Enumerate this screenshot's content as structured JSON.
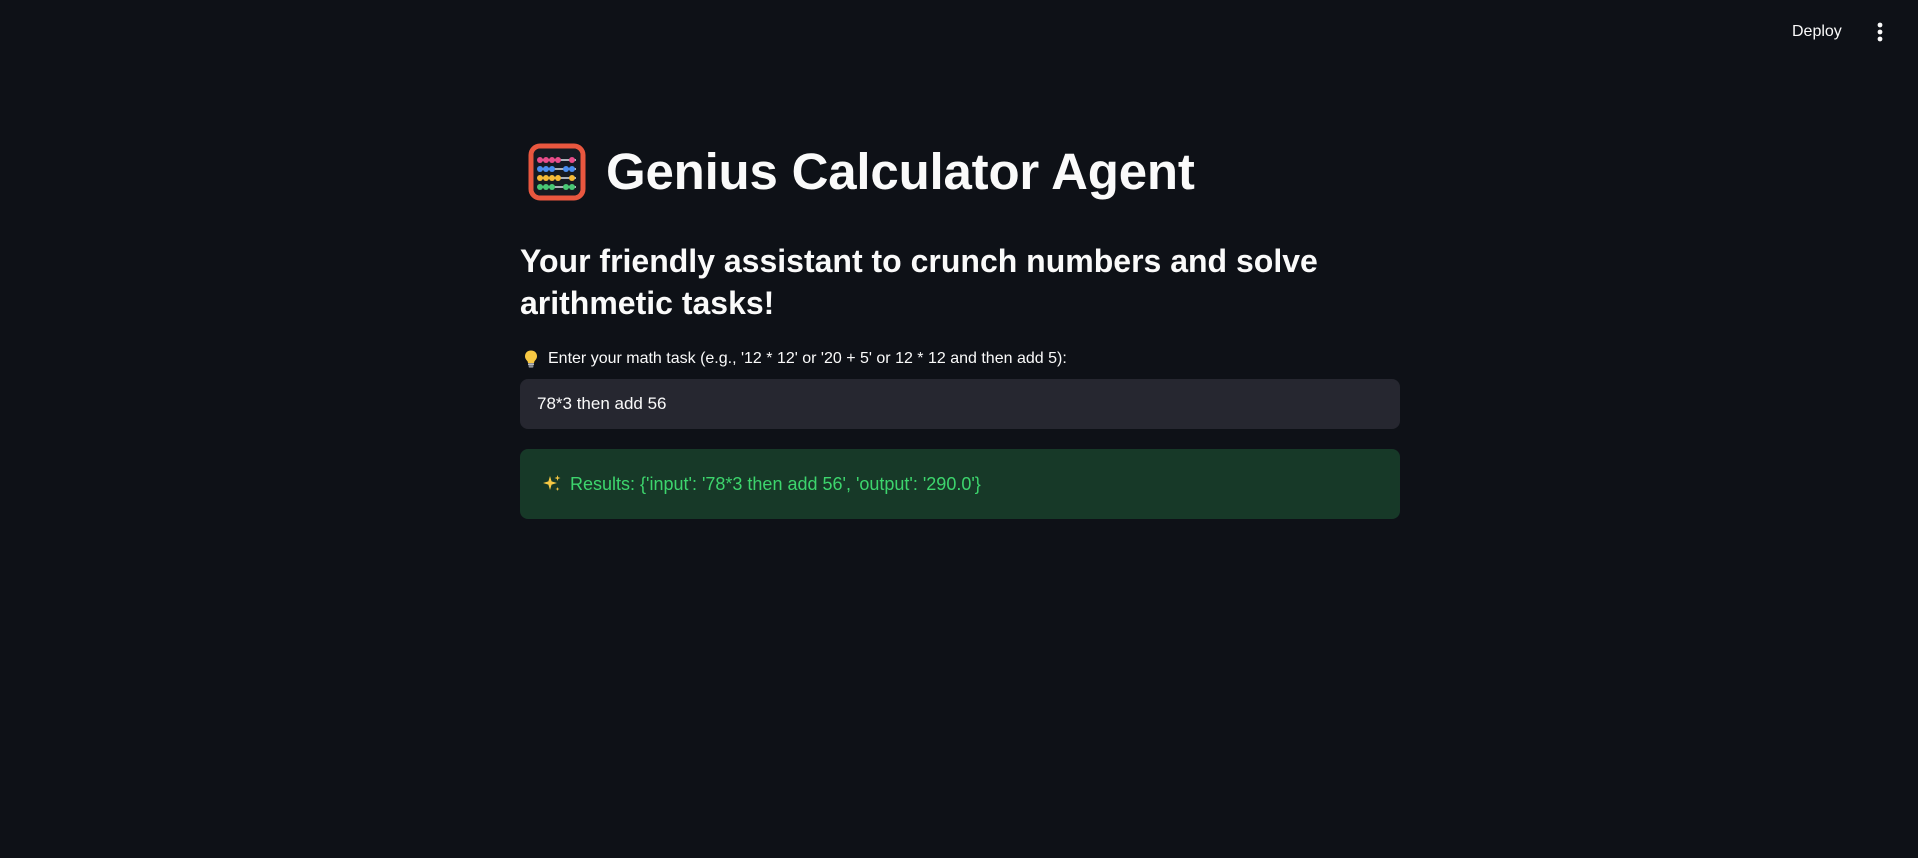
{
  "toolbar": {
    "deploy_label": "Deploy",
    "menu_icon": "more-vertical-icon"
  },
  "header": {
    "title_icon": "abacus-icon",
    "title": "Genius Calculator Agent",
    "subtitle": "Your friendly assistant to crunch numbers and solve arithmetic tasks!"
  },
  "form": {
    "label_icon": "light-bulb-icon",
    "label": "Enter your math task (e.g., '12 * 12' or '20 + 5' or 12 * 12 and then add 5):",
    "input_value": "78*3 then add 56"
  },
  "result": {
    "icon": "sparkles-icon",
    "text": "Results: {'input': '78*3 then add 56', 'output': '290.0'}"
  },
  "colors": {
    "background": "#0e1117",
    "input_background": "#262730",
    "success_background": "#173928",
    "success_text": "#3dd56d",
    "text": "#fafafa"
  }
}
